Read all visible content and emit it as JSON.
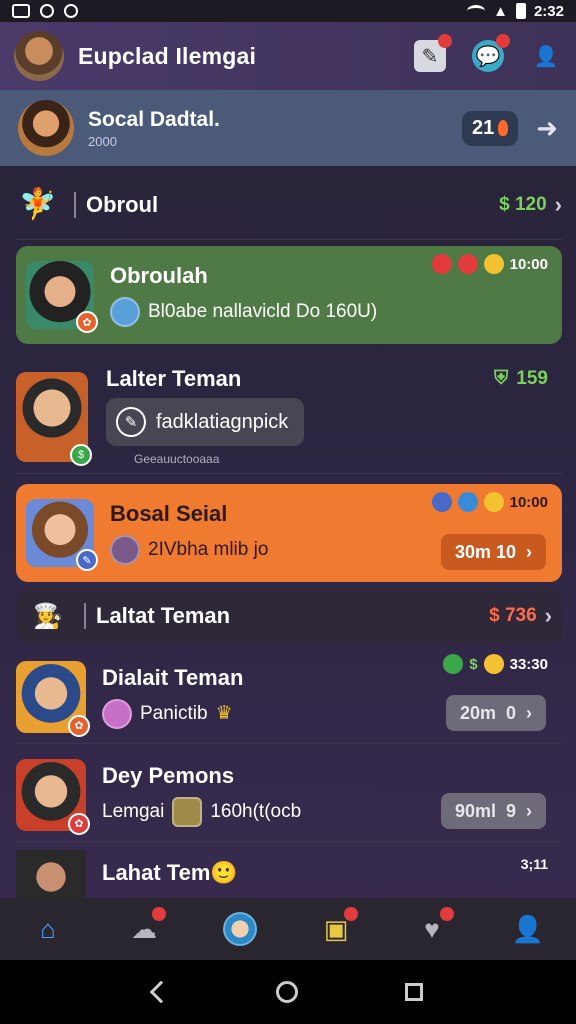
{
  "status_bar": {
    "time": "2:32"
  },
  "app": {
    "title": "Eupclad Ilemgai"
  },
  "pinned": {
    "name": "Socal Dadtal.",
    "sub": "2000",
    "count": "21"
  },
  "rows": [
    {
      "name": "Obroul",
      "amount": "$ 120"
    },
    {
      "name": "Obroulah",
      "message": "Bl0abe nallavicld Do 160U)",
      "time": "10:00"
    },
    {
      "name": "Lalter Teman",
      "amount": "159",
      "bubble": "fadklatiagnpick",
      "caption": "Geeauuctooaaa"
    },
    {
      "name": "Bosal Seial",
      "message": "2IVbha mlib jo",
      "time": "10:00",
      "button": "30m 10"
    },
    {
      "name": "Laltat Teman",
      "amount": "$ 736"
    },
    {
      "name": "Dialait Teman",
      "message": "Panictib",
      "time": "33:30",
      "button_left": "20m",
      "button_right": "0"
    },
    {
      "name": "Dey Pemons",
      "message_left": "Lemgai",
      "message_right": "160h(t(ocb",
      "button_left": "90ml",
      "button_right": "9"
    },
    {
      "name": "Lahat Tem",
      "time": "3;11"
    }
  ],
  "colors": {
    "accent_green": "#4f7a45",
    "accent_orange": "#f07a30",
    "header": "#3e3258"
  },
  "nav": {
    "items": [
      "home-icon",
      "chat-icon",
      "avatar-icon",
      "shop-icon",
      "heart-icon",
      "profile-icon"
    ]
  }
}
